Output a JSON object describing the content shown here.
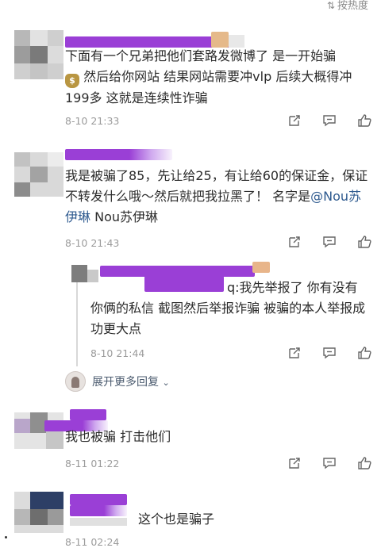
{
  "header": {
    "sort_label": "按热度",
    "sort_icon": "sort-arrows-icon"
  },
  "comments": [
    {
      "text_pre": "下面有一个兄弟把他们套路发微博了 是一开始骗",
      "emoji": "money-bag",
      "text_post": "然后给你网站 结果网站需要冲vlp 后续大概得冲199多 这就是连续性诈骗",
      "time": "8-10 21:33"
    },
    {
      "text": "我是被骗了85，先让给25，有让给60的保证金，保证不转发什么哦～然后就把我拉黑了！ 名字是",
      "mention": "@Nou苏伊琳",
      "text_tail": " Nou苏伊琳",
      "time": "8-10 21:43"
    },
    {
      "reply_text_prefix": "q:我先举报了 你有没有",
      "reply_text": "你俩的私信 截图然后举报诈骗 被骗的本人举报成功更大点",
      "time": "8-10 21:44",
      "expand_label": "展开更多回复"
    },
    {
      "text": "我也被骗 打击他们",
      "time": "8-11 01:22"
    },
    {
      "text": "这个也是骗子",
      "time": "8-11 02:24"
    }
  ],
  "icons": [
    "share-icon",
    "comment-icon",
    "like-icon"
  ],
  "colors": {
    "redaction": "#9a3fd6",
    "link": "#2e5a8f",
    "time": "#9b9b9b"
  }
}
